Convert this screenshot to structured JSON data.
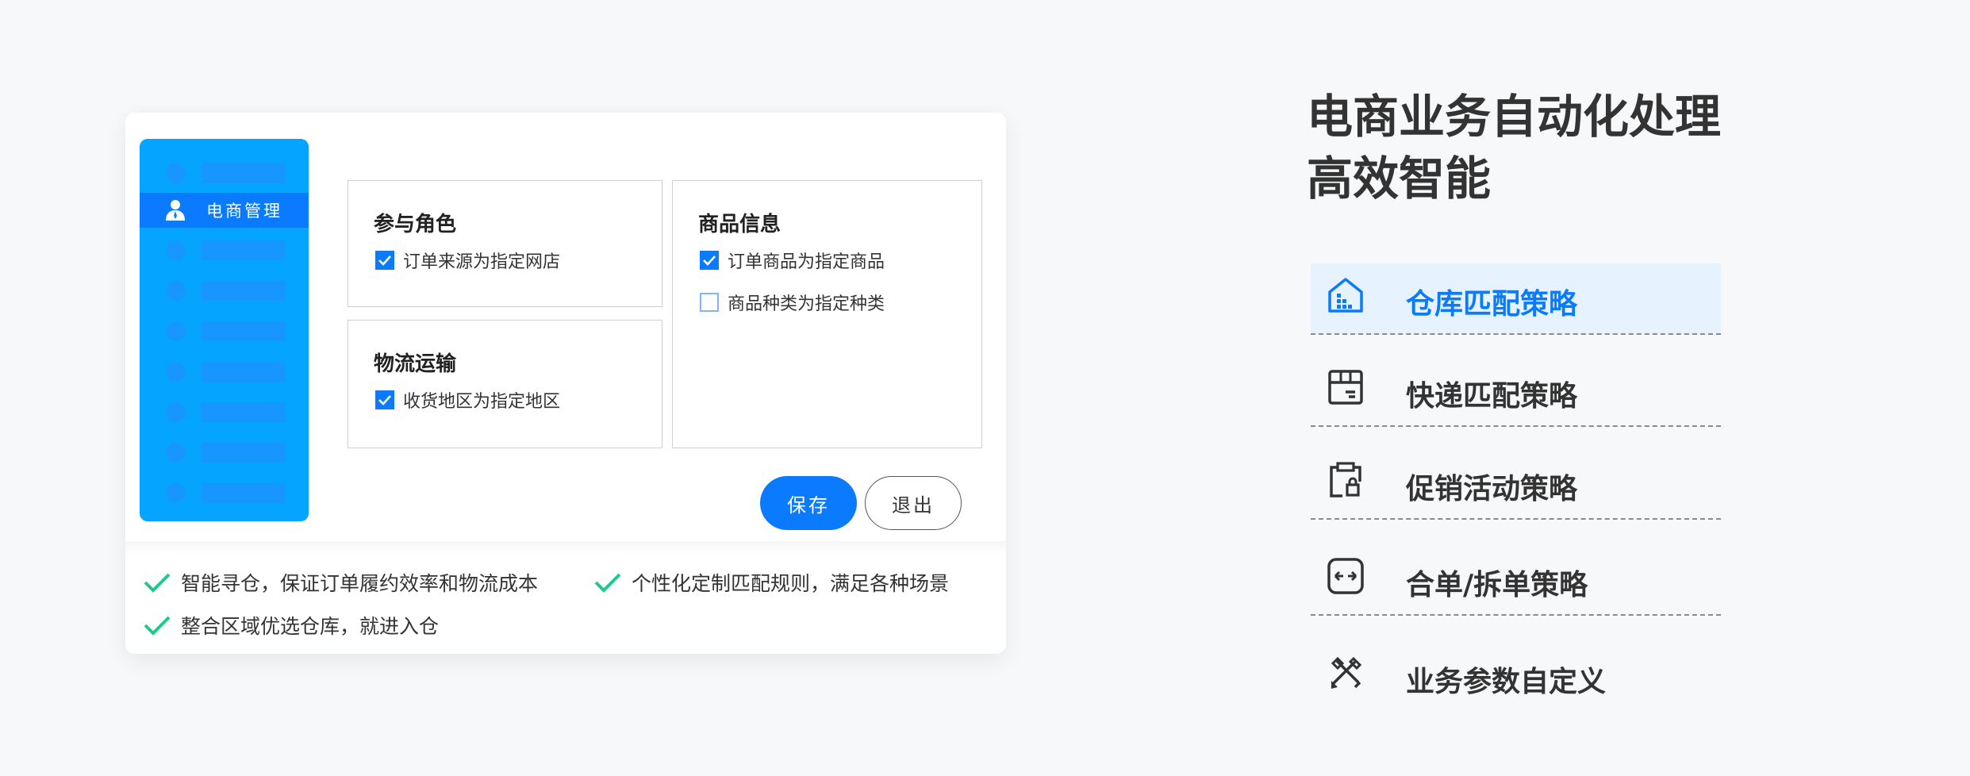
{
  "app": {
    "sidebar": {
      "active_label": "电商管理",
      "placeholder_rows": 8
    },
    "panels": {
      "role": {
        "title": "参与角色",
        "options": [
          {
            "label": "订单来源为指定网店",
            "checked": true
          }
        ]
      },
      "logistics": {
        "title": "物流运输",
        "options": [
          {
            "label": "收货地区为指定地区",
            "checked": true
          }
        ]
      },
      "product": {
        "title": "商品信息",
        "options": [
          {
            "label": "订单商品为指定商品",
            "checked": true
          },
          {
            "label": "商品种类为指定种类",
            "checked": false
          }
        ]
      }
    },
    "buttons": {
      "save": "保存",
      "exit": "退出"
    }
  },
  "features": [
    "智能寻仓，保证订单履约效率和物流成本",
    "个性化定制匹配规则，满足各种场景",
    "整合区域优选仓库，就进入仓"
  ],
  "headline": {
    "line1": "电商业务自动化处理",
    "line2": "高效智能"
  },
  "strategies": [
    {
      "label": "仓库匹配策略",
      "icon": "warehouse-icon",
      "active": true
    },
    {
      "label": "快递匹配策略",
      "icon": "package-icon",
      "active": false
    },
    {
      "label": "促销活动策略",
      "icon": "clipboard-lock-icon",
      "active": false
    },
    {
      "label": "合单/拆单策略",
      "icon": "merge-split-icon",
      "active": false
    },
    {
      "label": "业务参数自定义",
      "icon": "tools-icon",
      "active": false
    }
  ],
  "colors": {
    "accent": "#0a7bff",
    "sidebar": "#05a5ff",
    "check_green": "#1ec98a",
    "active_bg": "#e6f3ff",
    "text": "#333333"
  }
}
